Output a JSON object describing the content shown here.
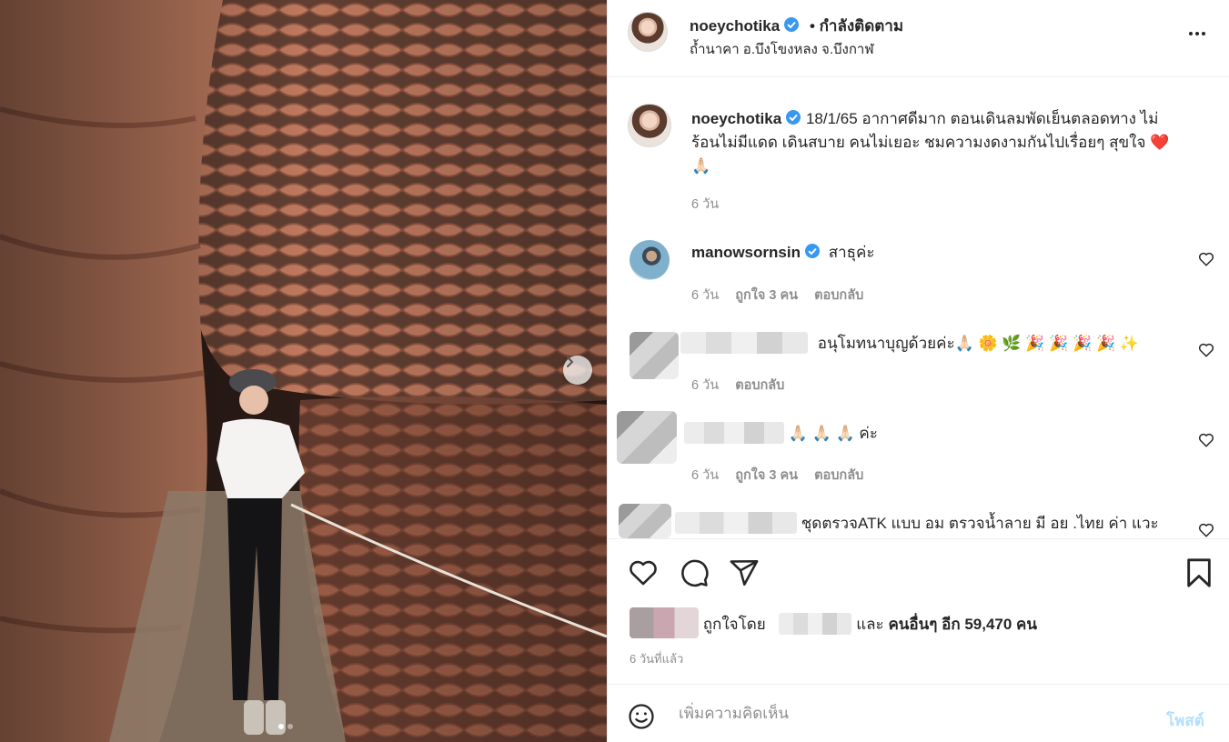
{
  "post_image": {
    "description_icon": "photo",
    "carousel_dots": 2,
    "active_dot": 1
  },
  "header": {
    "username": "noeychotika",
    "follow_status": "• กำลังติดตาม",
    "location": "ถ้ำนาคา อ.บึงโขงหลง จ.บึงกาฬ"
  },
  "caption": {
    "username": "noeychotika",
    "text_line1": "18/1/65 อากาศดีมาก ตอนเดินลมพัดเย็นตลอดทาง ไม่",
    "text_line2": "ร้อนไม่มีแดด เดินสบาย คนไม่เยอะ ชมความงดงามกันไปเรื่อยๆ สุขใจ ❤️",
    "text_line3": "🙏🏻",
    "time": "6 วัน"
  },
  "comments": [
    {
      "username": "manowsornsin",
      "text": "สาธุค่ะ",
      "time": "6 วัน",
      "likes": "ถูกใจ 3 คน",
      "reply": "ตอบกลับ"
    },
    {
      "username": "",
      "text": "อนุโมทนาบุญด้วยค่ะ🙏🏻 🌼 🌿 🎉 🎉 🎉 🎉 ✨",
      "time": "6 วัน",
      "reply": "ตอบกลับ"
    },
    {
      "username": "",
      "text": "🙏🏻 🙏🏻 🙏🏻 ค่ะ",
      "time": "6 วัน",
      "likes": "ถูกใจ 3 คน",
      "reply": "ตอบกลับ"
    },
    {
      "username": "",
      "text": "ชุดตรวจATK แบบ อม ตรวจน้ำลาย มี อย .ไทย ค่า แวะ"
    }
  ],
  "likes": {
    "prefix": "ถูกใจโดย",
    "and": "และ",
    "others": "คนอื่นๆ อีก 59,470 คน"
  },
  "time_ago": "6 วันที่แล้ว",
  "composer": {
    "placeholder": "เพิ่มความคิดเห็น",
    "post_label": "โพสต์"
  },
  "colors": {
    "verified": "#3897f0",
    "post_button_disabled": "#b2dffc",
    "secondary_text": "#8e8e8e"
  }
}
